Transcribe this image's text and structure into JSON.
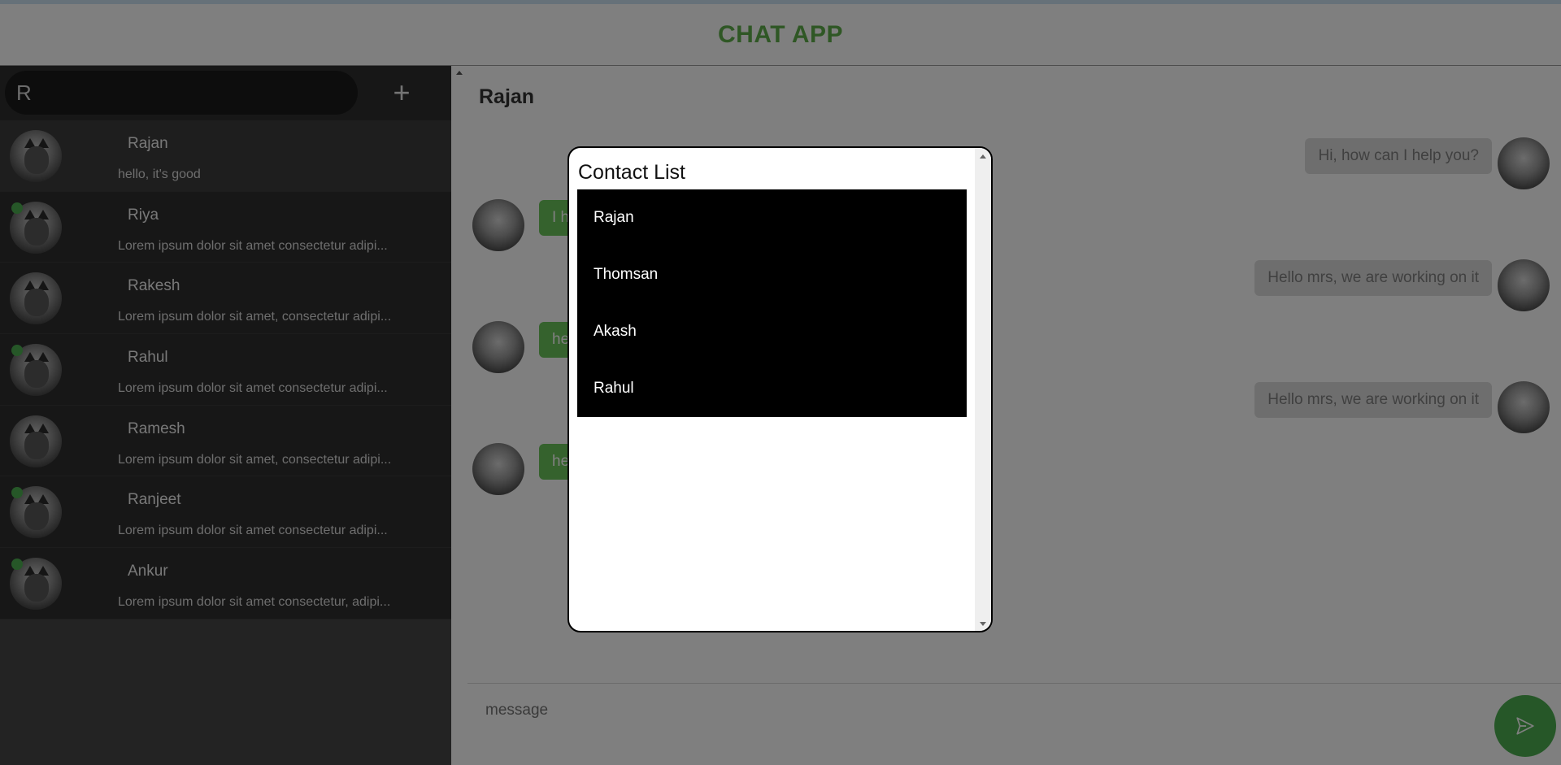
{
  "app": {
    "title": "CHAT APP",
    "accent": "#5fae4a"
  },
  "sidebar": {
    "search": {
      "value": "R"
    },
    "add_label": "+",
    "contacts": [
      {
        "name": "Rajan",
        "preview": "hello, it's good",
        "online": false,
        "active": true
      },
      {
        "name": "Riya",
        "preview": "Lorem ipsum dolor sit amet consectetur adipi...",
        "online": true,
        "active": false
      },
      {
        "name": "Rakesh",
        "preview": "Lorem ipsum dolor sit amet, consectetur adipi...",
        "online": false,
        "active": false
      },
      {
        "name": "Rahul",
        "preview": "Lorem ipsum dolor sit amet consectetur adipi...",
        "online": true,
        "active": false
      },
      {
        "name": "Ramesh",
        "preview": "Lorem ipsum dolor sit amet, consectetur adipi...",
        "online": false,
        "active": false
      },
      {
        "name": "Ranjeet",
        "preview": "Lorem ipsum dolor sit amet consectetur adipi...",
        "online": true,
        "active": false
      },
      {
        "name": "Ankur",
        "preview": "Lorem ipsum dolor sit amet consectetur, adipi...",
        "online": true,
        "active": false
      }
    ]
  },
  "chat": {
    "title": "Rajan",
    "messages": [
      {
        "direction": "out",
        "text": "Hi, how can I help you?"
      },
      {
        "direction": "in",
        "text": "I h"
      },
      {
        "direction": "out",
        "text": "Hello mrs, we are working on it"
      },
      {
        "direction": "in",
        "text": "he"
      },
      {
        "direction": "out",
        "text": "Hello mrs, we are working on it"
      },
      {
        "direction": "in",
        "text": "he"
      }
    ],
    "composer": {
      "placeholder": "message"
    }
  },
  "modal": {
    "title": "Contact List",
    "items": [
      "Rajan",
      "Thomsan",
      "Akash",
      "Rahul"
    ]
  },
  "icons": {
    "send": "send-icon",
    "avatar": "cat-avatar-icon",
    "add": "plus-icon"
  }
}
